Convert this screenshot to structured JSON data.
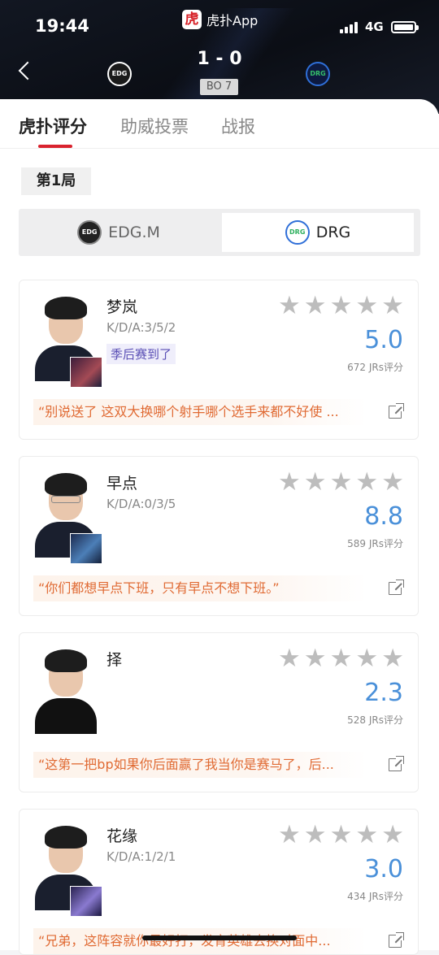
{
  "status_bar": {
    "time": "19:44",
    "app_name": "虎扑App",
    "app_logo_char": "虎",
    "network": "4G"
  },
  "match": {
    "score": "1 - 0",
    "format": "BO 7",
    "home_team_logo_text": "EDG",
    "away_team_logo_text": "DRG"
  },
  "tabs": [
    {
      "label": "虎扑评分",
      "active": true
    },
    {
      "label": "助威投票",
      "active": false
    },
    {
      "label": "战报",
      "active": false
    }
  ],
  "round_label": "第1局",
  "team_toggle": [
    {
      "name": "EDG.M",
      "selected": false
    },
    {
      "name": "DRG",
      "selected": true
    }
  ],
  "players": [
    {
      "name": "梦岚",
      "kda": "K/D/A:3/5/2",
      "tag": "季后赛到了",
      "rating": "5.0",
      "votes": "672 JRs评分",
      "quote": "“别说送了 这双大换哪个射手哪个选手来都不好使 ..."
    },
    {
      "name": "早点",
      "kda": "K/D/A:0/3/5",
      "tag": "",
      "rating": "8.8",
      "votes": "589 JRs评分",
      "quote": "“你们都想早点下班，只有早点不想下班。”"
    },
    {
      "name": "择",
      "kda": "",
      "tag": "",
      "rating": "2.3",
      "votes": "528 JRs评分",
      "quote": "“这第一把bp如果你后面赢了我当你是赛马了，后..."
    },
    {
      "name": "花缘",
      "kda": "K/D/A:1/2/1",
      "tag": "",
      "rating": "3.0",
      "votes": "434 JRs评分",
      "quote": "“兄弟，这阵容就你最好打，发育英雄去换对面中..."
    }
  ],
  "star_glyph": "★",
  "colors": {
    "accent_red": "#d9232e",
    "rating_blue": "#4a90d9",
    "quote_orange": "#e06a33"
  }
}
